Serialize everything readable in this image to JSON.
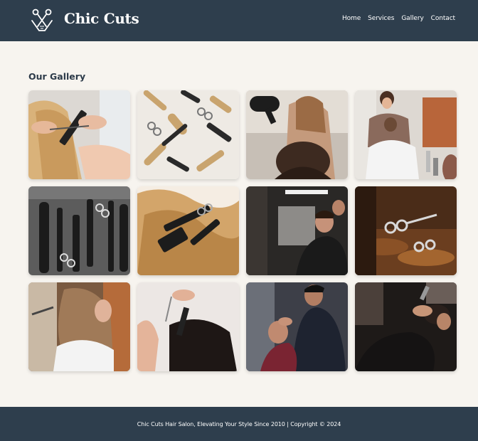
{
  "header": {
    "brand": "Chic Cuts",
    "logo_icon": "scissors-comb-logo",
    "nav": [
      {
        "label": "Home"
      },
      {
        "label": "Services"
      },
      {
        "label": "Gallery"
      },
      {
        "label": "Contact"
      }
    ]
  },
  "gallery": {
    "title": "Our Gallery",
    "images": [
      {
        "subject": "scissors-cutting-blonde-hair"
      },
      {
        "subject": "hair-tools-flat-lay"
      },
      {
        "subject": "stylist-blow-drying-hair"
      },
      {
        "subject": "stylist-with-child-client"
      },
      {
        "subject": "combs-and-scissors-monochrome"
      },
      {
        "subject": "tools-on-blonde-hair"
      },
      {
        "subject": "barber-shop-client"
      },
      {
        "subject": "scissors-on-wooden-table"
      },
      {
        "subject": "woman-with-long-hair-side"
      },
      {
        "subject": "combing-dark-wet-hair"
      },
      {
        "subject": "barber-styling-client"
      },
      {
        "subject": "barber-trimming-close-up"
      }
    ]
  },
  "footer": {
    "text": "Chic Cuts Hair Salon, Elevating Your Style Since 2010 | Copyright © 2024"
  },
  "colors": {
    "header_bg": "#2e3e4d",
    "page_bg": "#f7f4ef",
    "text": "#2c3a49"
  }
}
